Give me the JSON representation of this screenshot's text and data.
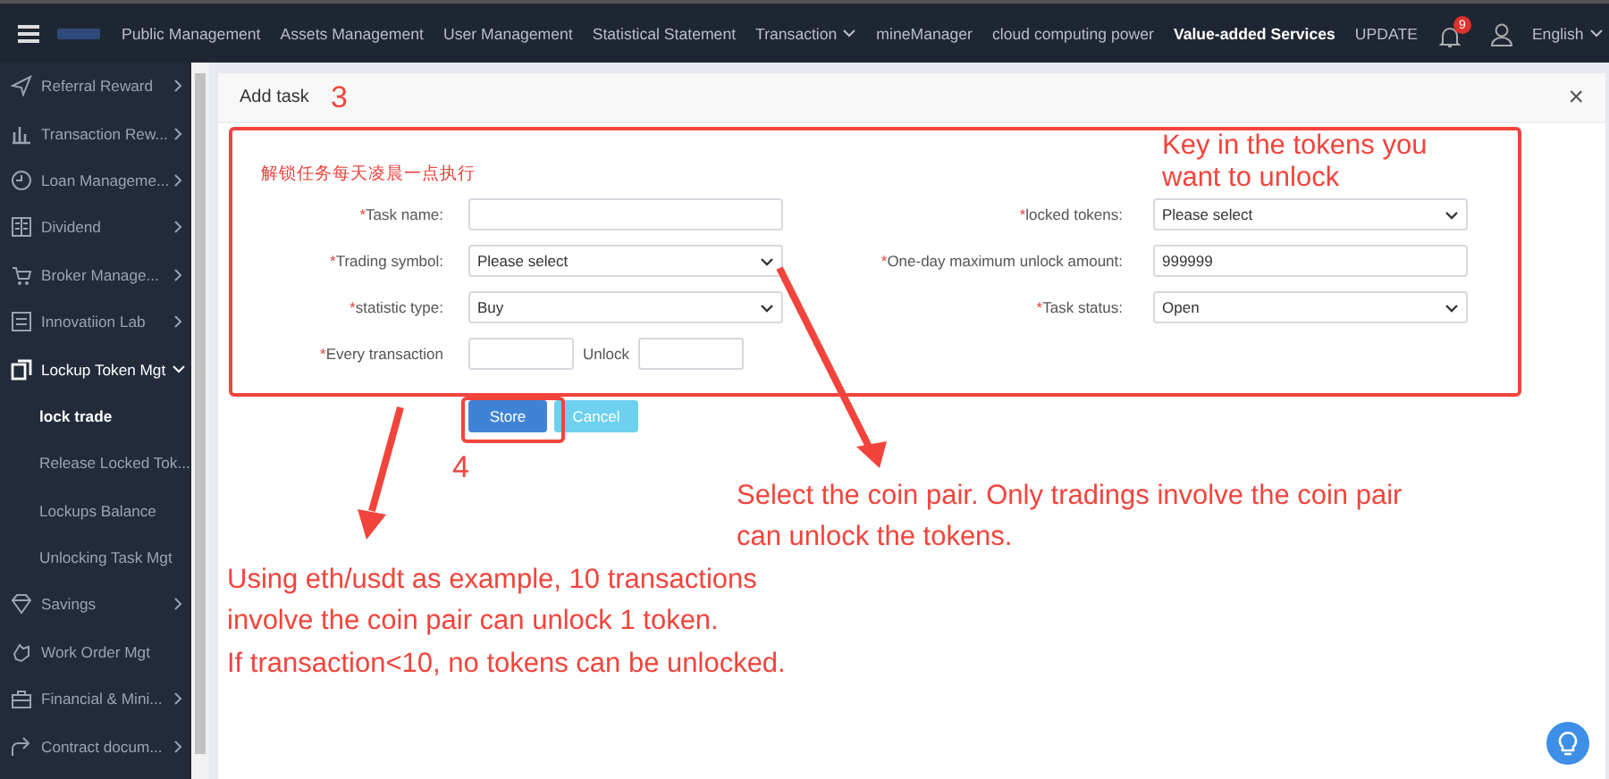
{
  "top_nav": {
    "items": [
      {
        "label": "Public Management",
        "selected": false,
        "dropdown": false
      },
      {
        "label": "Assets Management",
        "selected": false,
        "dropdown": false
      },
      {
        "label": "User Management",
        "selected": false,
        "dropdown": false
      },
      {
        "label": "Statistical Statement",
        "selected": false,
        "dropdown": false
      },
      {
        "label": "Transaction",
        "selected": false,
        "dropdown": true
      },
      {
        "label": "mineManager",
        "selected": false,
        "dropdown": false
      },
      {
        "label": "cloud computing power",
        "selected": false,
        "dropdown": false
      },
      {
        "label": "Value-added Services",
        "selected": true,
        "dropdown": false
      },
      {
        "label": "UPDATE",
        "selected": false,
        "dropdown": false
      }
    ],
    "notification_count": "9",
    "language": "English"
  },
  "sidebar": {
    "items": [
      {
        "label": "Referral Reward",
        "has_submenu": true,
        "expanded": false
      },
      {
        "label": "Transaction Rew...",
        "has_submenu": true,
        "expanded": false
      },
      {
        "label": "Loan Manageme...",
        "has_submenu": true,
        "expanded": false
      },
      {
        "label": "Dividend",
        "has_submenu": true,
        "expanded": false
      },
      {
        "label": "Broker Manage...",
        "has_submenu": true,
        "expanded": false
      },
      {
        "label": "Innovatiion Lab",
        "has_submenu": true,
        "expanded": false
      },
      {
        "label": "Lockup Token Mgt",
        "has_submenu": true,
        "expanded": true,
        "children": [
          {
            "label": "lock trade",
            "selected": true
          },
          {
            "label": "Release Locked Tok...",
            "selected": false
          },
          {
            "label": "Lockups Balance",
            "selected": false
          },
          {
            "label": "Unlocking Task Mgt",
            "selected": false
          }
        ]
      },
      {
        "label": "Savings",
        "has_submenu": true,
        "expanded": false
      },
      {
        "label": "Work Order Mgt",
        "has_submenu": false,
        "expanded": false
      },
      {
        "label": "Financial & Mini...",
        "has_submenu": true,
        "expanded": false
      },
      {
        "label": "Contract docum...",
        "has_submenu": true,
        "expanded": false
      }
    ]
  },
  "modal": {
    "title": "Add task",
    "close": "×",
    "note": "解锁任务每天凌晨一点执行",
    "rows": [
      {
        "fields": [
          {
            "kind": "text",
            "mark": "*",
            "label": "Task name:"
          },
          {
            "kind": "select",
            "mark": "*",
            "label": "locked tokens:",
            "value": "Please select"
          }
        ]
      },
      {
        "fields": [
          {
            "kind": "select",
            "mark": "*",
            "label": "Trading symbol:",
            "value": "Please select"
          },
          {
            "kind": "text",
            "mark": "*",
            "label": "One-day maximum unlock amount:",
            "value": "999999"
          }
        ]
      },
      {
        "fields": [
          {
            "kind": "select",
            "mark": "*",
            "label": "statistic type:",
            "value": "Buy"
          },
          {
            "kind": "select",
            "mark": "*",
            "label": "Task status:",
            "value": "Open"
          }
        ]
      },
      {
        "fields": [
          {
            "kind": "pair",
            "mark": "*",
            "label": "Every transaction",
            "second_label": "Unlock"
          }
        ]
      }
    ],
    "buttons": [
      {
        "label": "Store",
        "kind": "primary"
      },
      {
        "label": "Cancel",
        "kind": "secondary"
      }
    ]
  },
  "annotations": [
    {
      "kind": "step",
      "text": "3"
    },
    {
      "kind": "step",
      "text": "4"
    },
    {
      "kind": "note",
      "text": "Key in the tokens you\nwant to unlock"
    },
    {
      "kind": "note",
      "text": "Select the coin pair. Only tradings involve the coin pair\ncan unlock the tokens."
    },
    {
      "kind": "note",
      "text": "Using eth/usdt as example, 10 transactions\ninvolve the coin pair can unlock 1 token.\nIf transaction<10, no tokens can be unlocked."
    }
  ]
}
